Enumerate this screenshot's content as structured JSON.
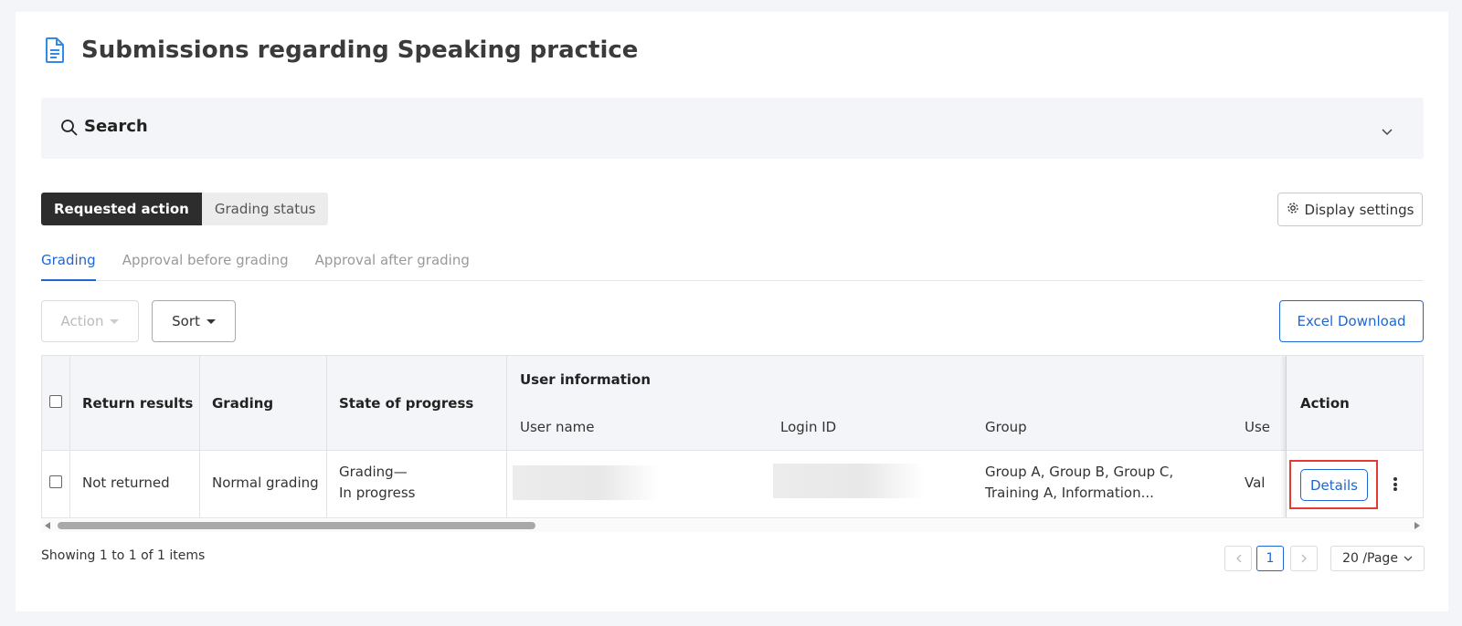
{
  "page": {
    "title": "Submissions regarding Speaking practice"
  },
  "search": {
    "label": "Search"
  },
  "segments": {
    "requested_action": "Requested action",
    "grading_status": "Grading status"
  },
  "display_settings": "Display settings",
  "tabs": [
    "Grading",
    "Approval before grading",
    "Approval after grading"
  ],
  "toolbar": {
    "action": "Action",
    "sort": "Sort",
    "excel_download": "Excel Download"
  },
  "table": {
    "headers": {
      "return_results": "Return results",
      "grading": "Grading",
      "state_of_progress": "State of progress",
      "user_information": "User information",
      "user_name": "User name",
      "login_id": "Login ID",
      "group": "Group",
      "user_extra": "Use",
      "action": "Action"
    },
    "rows": [
      {
        "return_results": "Not returned",
        "grading": "Normal grading",
        "state_line1": "Grading—",
        "state_line2": "In progress",
        "group_line1": "Group A, Group B, Group C,",
        "group_line2": "Training A, Information...",
        "user_extra": "Val",
        "details": "Details"
      }
    ]
  },
  "footer": {
    "showing": "Showing 1 to 1 of 1 items",
    "current_page": "1",
    "page_size": "20 /Page"
  },
  "colors": {
    "accent": "#1f66d0",
    "highlight": "#e53935"
  }
}
